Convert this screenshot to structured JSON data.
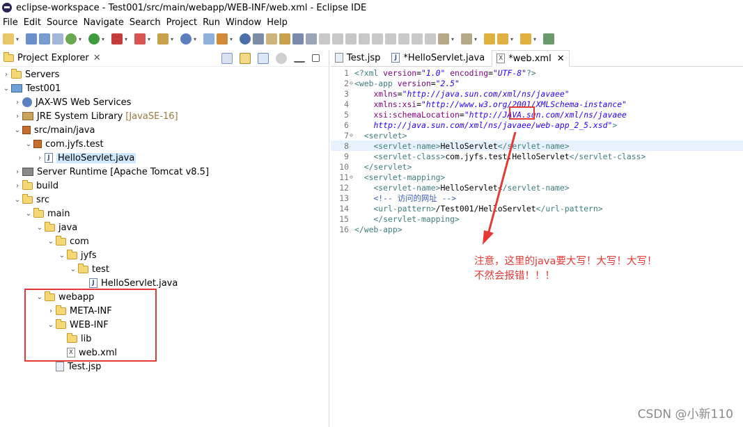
{
  "window": {
    "title": "eclipse-workspace - Test001/src/main/webapp/WEB-INF/web.xml - Eclipse IDE"
  },
  "menu": [
    "File",
    "Edit",
    "Source",
    "Navigate",
    "Search",
    "Project",
    "Run",
    "Window",
    "Help"
  ],
  "explorer": {
    "tab_label": "Project Explorer",
    "rows": [
      {
        "label": "Servers",
        "extra": "",
        "level": 0,
        "arrow": "›",
        "icon": "folder"
      },
      {
        "label": "Test001",
        "extra": "",
        "level": 0,
        "arrow": "⌄",
        "icon": "proj"
      },
      {
        "label": "JAX-WS Web Services",
        "extra": "",
        "level": 1,
        "arrow": "›",
        "icon": "ws"
      },
      {
        "label": "JRE System Library",
        "extra": "[JavaSE-16]",
        "level": 1,
        "arrow": "›",
        "icon": "lib"
      },
      {
        "label": "src/main/java",
        "extra": "",
        "level": 1,
        "arrow": "⌄",
        "icon": "pkg"
      },
      {
        "label": "com.jyfs.test",
        "extra": "",
        "level": 2,
        "arrow": "⌄",
        "icon": "pkg"
      },
      {
        "label": "HelloServlet.java",
        "extra": "",
        "level": 3,
        "arrow": "›",
        "icon": "jfile",
        "selected": true
      },
      {
        "label": "Server Runtime [Apache Tomcat v8.5]",
        "extra": "",
        "level": 1,
        "arrow": "›",
        "icon": "srv"
      },
      {
        "label": "build",
        "extra": "",
        "level": 1,
        "arrow": "›",
        "icon": "folder"
      },
      {
        "label": "src",
        "extra": "",
        "level": 1,
        "arrow": "⌄",
        "icon": "folder"
      },
      {
        "label": "main",
        "extra": "",
        "level": 2,
        "arrow": "⌄",
        "icon": "folder"
      },
      {
        "label": "java",
        "extra": "",
        "level": 3,
        "arrow": "⌄",
        "icon": "folder"
      },
      {
        "label": "com",
        "extra": "",
        "level": 4,
        "arrow": "⌄",
        "icon": "folder"
      },
      {
        "label": "jyfs",
        "extra": "",
        "level": 5,
        "arrow": "⌄",
        "icon": "folder"
      },
      {
        "label": "test",
        "extra": "",
        "level": 6,
        "arrow": "⌄",
        "icon": "folder"
      },
      {
        "label": "HelloServlet.java",
        "extra": "",
        "level": 7,
        "arrow": "",
        "icon": "jfile"
      },
      {
        "label": "webapp",
        "extra": "",
        "level": 3,
        "arrow": "⌄",
        "icon": "folder"
      },
      {
        "label": "META-INF",
        "extra": "",
        "level": 4,
        "arrow": "›",
        "icon": "folder"
      },
      {
        "label": "WEB-INF",
        "extra": "",
        "level": 4,
        "arrow": "⌄",
        "icon": "folder"
      },
      {
        "label": "lib",
        "extra": "",
        "level": 5,
        "arrow": "",
        "icon": "folder"
      },
      {
        "label": "web.xml",
        "extra": "",
        "level": 5,
        "arrow": "",
        "icon": "xfile"
      },
      {
        "label": "Test.jsp",
        "extra": "",
        "level": 4,
        "arrow": "",
        "icon": "jsp"
      }
    ]
  },
  "editor": {
    "tabs": [
      {
        "label": "Test.jsp",
        "icon": "jsp",
        "active": false,
        "close": ""
      },
      {
        "label": "*HelloServlet.java",
        "icon": "jfile",
        "active": false,
        "close": ""
      },
      {
        "label": "*web.xml",
        "icon": "xfile",
        "active": true,
        "close": "✕"
      }
    ],
    "lines": [
      {
        "n": "1",
        "fold": "",
        "parts": [
          [
            "tg",
            "<?xml "
          ],
          [
            "at",
            "version"
          ],
          [
            "cl",
            "="
          ],
          [
            "av",
            "\"1.0\""
          ],
          [
            "cl",
            " "
          ],
          [
            "at",
            "encoding"
          ],
          [
            "cl",
            "="
          ],
          [
            "av",
            "\"UTF-8\""
          ],
          [
            "tg",
            "?>"
          ]
        ]
      },
      {
        "n": "2",
        "fold": "⊖",
        "parts": [
          [
            "tg",
            "<web-app "
          ],
          [
            "at",
            "version"
          ],
          [
            "cl",
            "="
          ],
          [
            "av",
            "\"2.5\""
          ]
        ]
      },
      {
        "n": "3",
        "fold": "",
        "parts": [
          [
            "cl",
            "    "
          ],
          [
            "at",
            "xmlns"
          ],
          [
            "cl",
            "="
          ],
          [
            "av",
            "\"http://java.sun.com/xml/ns/javaee\""
          ]
        ]
      },
      {
        "n": "4",
        "fold": "",
        "parts": [
          [
            "cl",
            "    "
          ],
          [
            "at",
            "xmlns:xsi"
          ],
          [
            "cl",
            "="
          ],
          [
            "av",
            "\"http://www.w3.org/2001/XMLSchema-instance\""
          ]
        ]
      },
      {
        "n": "5",
        "fold": "",
        "parts": [
          [
            "cl",
            "    "
          ],
          [
            "at",
            "xsi:schemaLocation"
          ],
          [
            "cl",
            "="
          ],
          [
            "av",
            "\"http://JAVA.sun.com/xml/ns/javaee"
          ]
        ]
      },
      {
        "n": "6",
        "fold": "",
        "parts": [
          [
            "cl",
            "    "
          ],
          [
            "av",
            "http://java.sun.com/xml/ns/javaee/web-app_2_5.xsd\""
          ],
          [
            "tg",
            ">"
          ]
        ]
      },
      {
        "n": "7",
        "fold": "⊖",
        "parts": [
          [
            "cl",
            "  "
          ],
          [
            "tg",
            "<servlet>"
          ]
        ]
      },
      {
        "n": "8",
        "fold": "",
        "hl": true,
        "parts": [
          [
            "cl",
            "    "
          ],
          [
            "tg",
            "<servlet-name>"
          ],
          [
            "cl",
            "HelloServlet"
          ],
          [
            "tg",
            "</servlet-name>"
          ]
        ]
      },
      {
        "n": "9",
        "fold": "",
        "parts": [
          [
            "cl",
            "    "
          ],
          [
            "tg",
            "<servlet-class>"
          ],
          [
            "cl",
            "com.jyfs.test.HelloServlet"
          ],
          [
            "tg",
            "</servlet-class>"
          ]
        ]
      },
      {
        "n": "10",
        "fold": "",
        "parts": [
          [
            "cl",
            "  "
          ],
          [
            "tg",
            "</servlet>"
          ]
        ]
      },
      {
        "n": "11",
        "fold": "⊖",
        "parts": [
          [
            "cl",
            "  "
          ],
          [
            "tg",
            "<servlet-mapping>"
          ]
        ]
      },
      {
        "n": "12",
        "fold": "",
        "parts": [
          [
            "cl",
            "    "
          ],
          [
            "tg",
            "<servlet-name>"
          ],
          [
            "cl",
            "HelloServlet"
          ],
          [
            "tg",
            "</servlet-name>"
          ]
        ]
      },
      {
        "n": "13",
        "fold": "",
        "parts": [
          [
            "cl",
            "    "
          ],
          [
            "cm",
            "<!-- 访问的网址 -->"
          ]
        ]
      },
      {
        "n": "14",
        "fold": "",
        "parts": [
          [
            "cl",
            "    "
          ],
          [
            "tg",
            "<url-pattern>"
          ],
          [
            "cl",
            "/Test001/HelloServlet"
          ],
          [
            "tg",
            "</url-pattern>"
          ]
        ]
      },
      {
        "n": "15",
        "fold": "",
        "parts": [
          [
            "cl",
            "    "
          ],
          [
            "tg",
            "</servlet-mapping>"
          ]
        ]
      },
      {
        "n": "16",
        "fold": "",
        "parts": [
          [
            "tg",
            "</web-app>"
          ]
        ]
      }
    ]
  },
  "annotation": {
    "line1": "注意，这里的java要大写！大写！大写！",
    "line2": "不然会报错！！！"
  },
  "watermark": "CSDN @小新110"
}
